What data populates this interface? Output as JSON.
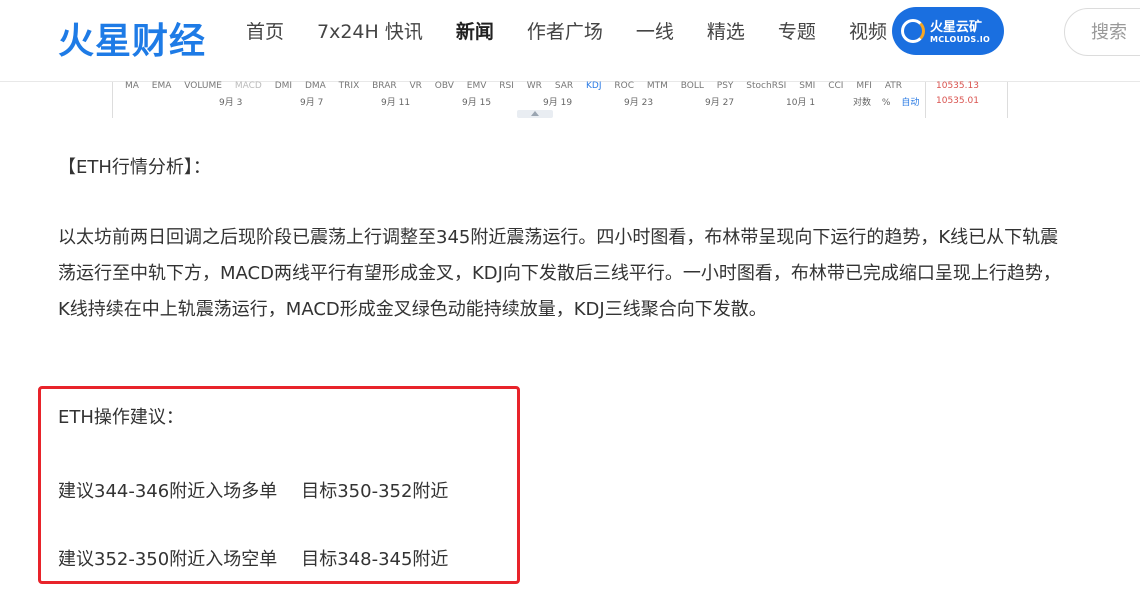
{
  "header": {
    "logo": "火星财经",
    "nav": [
      {
        "label": "首页",
        "active": false
      },
      {
        "label": "7x24H 快讯",
        "active": false
      },
      {
        "label": "新闻",
        "active": true
      },
      {
        "label": "作者广场",
        "active": false
      },
      {
        "label": "一线",
        "active": false
      },
      {
        "label": "精选",
        "active": false
      },
      {
        "label": "专题",
        "active": false
      },
      {
        "label": "视频",
        "active": false
      }
    ],
    "mclouds": {
      "name": "火星云矿",
      "sub": "MCLOUDS.IO"
    },
    "search_placeholder": "搜索"
  },
  "chart_strip": {
    "indicators": [
      "MA",
      "EMA",
      "VOLUME",
      "MACD",
      "DMI",
      "DMA",
      "TRIX",
      "BRAR",
      "VR",
      "OBV",
      "EMV",
      "RSI",
      "WR",
      "SAR",
      "KDJ",
      "ROC",
      "MTM",
      "BOLL",
      "PSY",
      "StochRSI",
      "SMI",
      "CCI",
      "MFI",
      "ATR"
    ],
    "dates": [
      "9月 3",
      "9月 7",
      "9月 11",
      "9月 15",
      "9月 19",
      "9月 23",
      "9月 27",
      "10月 1"
    ],
    "axis_options": {
      "log": "对数",
      "percent": "%",
      "auto": "自动"
    },
    "prices": [
      "10535.13",
      "10535.01"
    ]
  },
  "article": {
    "section_title": "【ETH行情分析】：",
    "paragraph": "以太坊前两日回调之后现阶段已震荡上行调整至345附近震荡运行。四小时图看，布林带呈现向下运行的趋势，K线已从下轨震荡运行至中轨下方，MACD两线平行有望形成金叉，KDJ向下发散后三线平行。一小时图看，布林带已完成缩口呈现上行趋势，K线持续在中上轨震荡运行，MACD形成金叉绿色动能持续放量，KDJ三线聚合向下发散。",
    "advice_title": "ETH操作建议：",
    "advice": [
      {
        "entry": "建议344-346附近入场多单",
        "target": "目标350-352附近"
      },
      {
        "entry": "建议352-350附近入场空单",
        "target": "目标348-345附近"
      }
    ]
  },
  "colors": {
    "brand_blue": "#1e7be6",
    "highlight_red": "#e8232a",
    "price_red": "#d9534f"
  }
}
